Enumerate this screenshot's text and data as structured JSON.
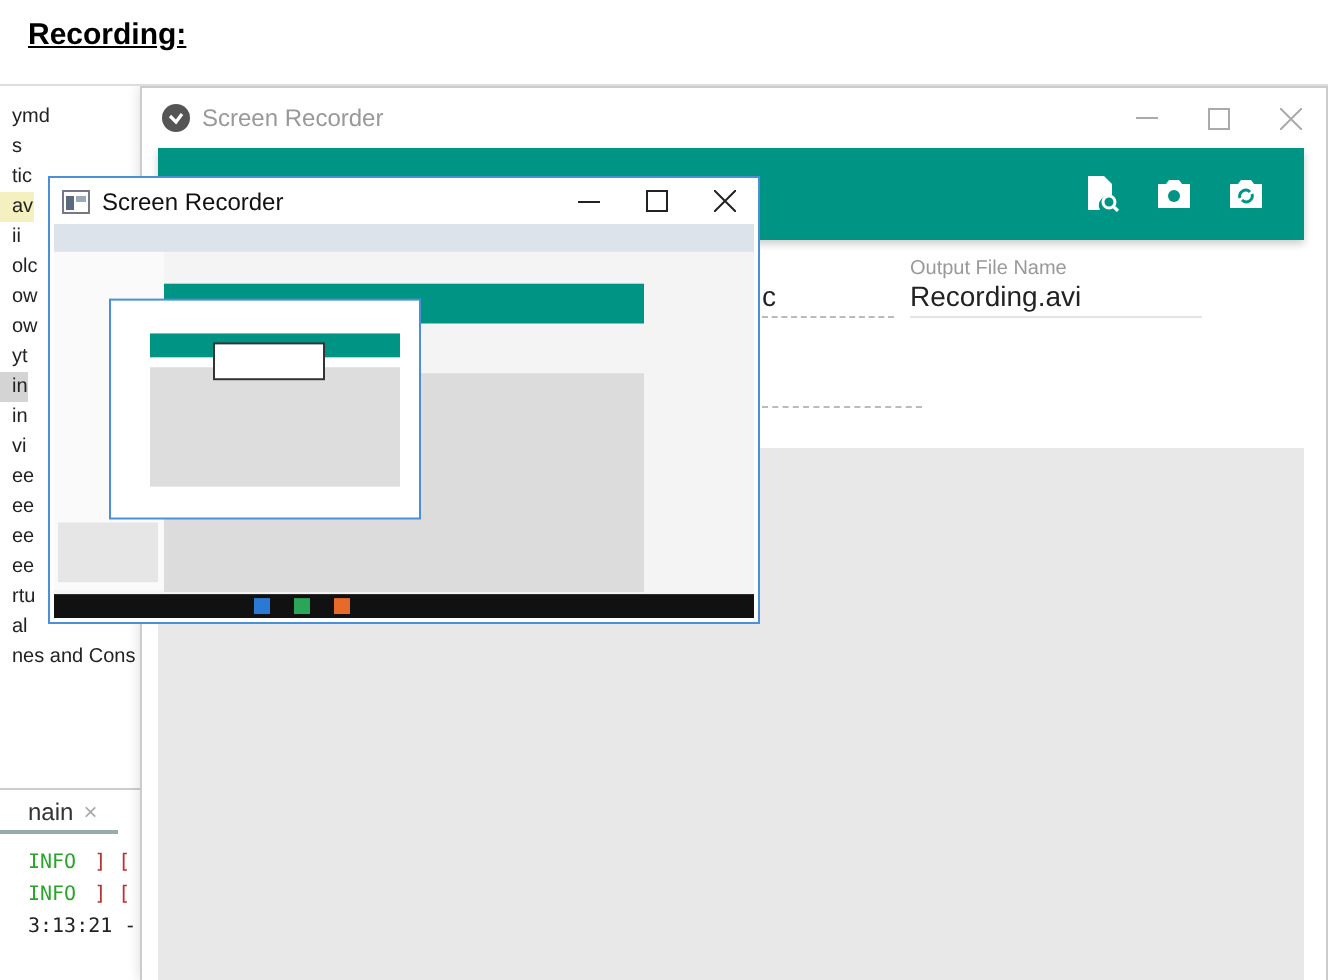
{
  "heading": "Recording:",
  "ide": {
    "tree_items": [
      {
        "text": "ymd",
        "selected": false,
        "marked": false
      },
      {
        "text": "s",
        "selected": false,
        "marked": false
      },
      {
        "text": "tic",
        "selected": false,
        "marked": false
      },
      {
        "text": "av",
        "selected": false,
        "marked": true
      },
      {
        "text": "ii",
        "selected": false,
        "marked": false
      },
      {
        "text": "olc",
        "selected": false,
        "marked": false
      },
      {
        "text": "ow",
        "selected": false,
        "marked": false
      },
      {
        "text": "ow",
        "selected": false,
        "marked": false
      },
      {
        "text": "yt",
        "selected": false,
        "marked": false
      },
      {
        "text": "in",
        "selected": true,
        "marked": false
      },
      {
        "text": "in",
        "selected": false,
        "marked": false
      },
      {
        "text": "vi",
        "selected": false,
        "marked": false
      },
      {
        "text": "ee",
        "selected": false,
        "marked": false
      },
      {
        "text": "ee",
        "selected": false,
        "marked": false
      },
      {
        "text": "ee",
        "selected": false,
        "marked": false
      },
      {
        "text": "ee",
        "selected": false,
        "marked": false
      },
      {
        "text": "rtu",
        "selected": false,
        "marked": false
      },
      {
        "text": "al",
        "selected": false,
        "marked": false
      },
      {
        "text": "nes and Cons",
        "selected": false,
        "marked": false
      }
    ],
    "console_tab": {
      "label": "nain",
      "close": "×"
    },
    "console_lines": [
      {
        "kind": "level",
        "level": "INFO",
        "tail": "] ["
      },
      {
        "kind": "level",
        "level": "INFO",
        "tail": "] ["
      },
      {
        "kind": "plain",
        "text": "3:13:21 -"
      }
    ]
  },
  "main_window": {
    "title": "Screen Recorder",
    "fields": [
      {
        "value": "c"
      },
      {
        "label": "Output File Name",
        "value": "Recording.avi"
      }
    ]
  },
  "overlay_window": {
    "title": "Screen Recorder"
  }
}
